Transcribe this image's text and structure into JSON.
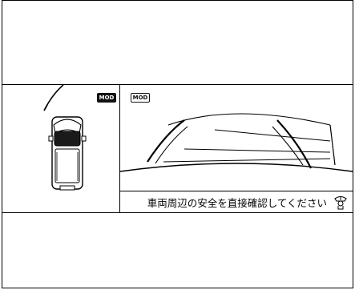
{
  "display": {
    "top_view": {
      "mode_badge": "MOD"
    },
    "rear_camera_view": {
      "mode_badge": "MOD"
    },
    "notice": {
      "message": "車両周辺の安全を直接確認してください",
      "icon": "caution-driver-icon"
    }
  },
  "colors": {
    "line": "#000000",
    "background": "#ffffff",
    "badge_fill": "#111111"
  }
}
